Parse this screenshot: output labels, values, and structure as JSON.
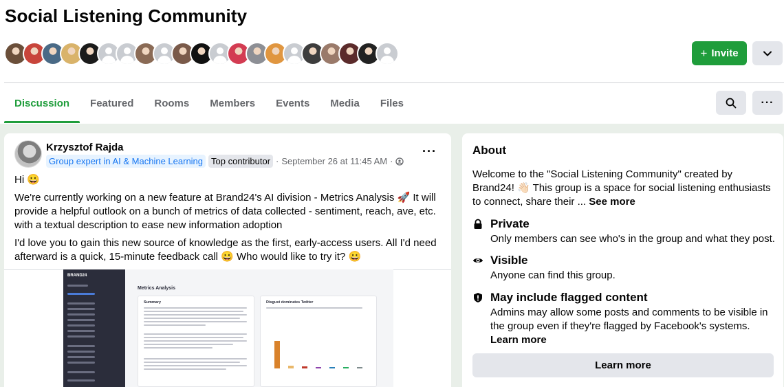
{
  "group": {
    "title": "Social Listening Community",
    "invite_label": "Invite",
    "members_avatars": [
      {
        "color": "#6b4f3a"
      },
      {
        "color": "#c8453b"
      },
      {
        "color": "#4a6a86"
      },
      {
        "color": "#d9b36a"
      },
      {
        "color": "#1b1b1b"
      },
      {
        "color": "blank"
      },
      {
        "color": "blank"
      },
      {
        "color": "#8a6a55"
      },
      {
        "color": "blank"
      },
      {
        "color": "#7a5a4a"
      },
      {
        "color": "#111111"
      },
      {
        "color": "blank"
      },
      {
        "color": "#d33c52"
      },
      {
        "color": "#8d8f95"
      },
      {
        "color": "#e09640"
      },
      {
        "color": "blank"
      },
      {
        "color": "#3d3d3d"
      },
      {
        "color": "#9a7a6a"
      },
      {
        "color": "#5b2b2b"
      },
      {
        "color": "#222222"
      },
      {
        "color": "blank"
      }
    ]
  },
  "tabs": [
    {
      "label": "Discussion"
    },
    {
      "label": "Featured"
    },
    {
      "label": "Rooms"
    },
    {
      "label": "Members"
    },
    {
      "label": "Events"
    },
    {
      "label": "Media"
    },
    {
      "label": "Files"
    }
  ],
  "post": {
    "author": "Krzysztof Rajda",
    "badge_expert": "Group expert in AI & Machine Learning",
    "badge_contributor": "Top contributor",
    "timestamp": "September 26 at 11:45 AM",
    "line1": "Hi 😀",
    "line2": "We're currently working on a new feature at Brand24's AI division - Metrics Analysis 🚀 It will provide a helpful outlook on a bunch of metrics of data collected - sentiment, reach, ave, etc. with a textual description to ease new information adoption",
    "line3": "I'd love you to gain this new source of knowledge as the first, early-access users. All I'd need afterward is a quick, 15-minute feedback call 😀 Who would like to try it? 😀",
    "screenshot": {
      "app_logo": "BRAND24",
      "page_title": "Metrics Analysis",
      "card1_title": "Summary",
      "card2_title": "Disgust dominates Twitter"
    }
  },
  "about": {
    "title": "About",
    "description": "Welcome to the \"Social Listening Community\" created by Brand24! 👋🏻 This group is a space for social listening enthusiasts to connect, share their ...",
    "see_more": "See more",
    "private_title": "Private",
    "private_desc": "Only members can see who's in the group and what they post.",
    "visible_title": "Visible",
    "visible_desc": "Anyone can find this group.",
    "flagged_title": "May include flagged content",
    "flagged_desc": "Admins may allow some posts and comments to be visible in the group even if they're flagged by Facebook's systems.",
    "flagged_learn_more": "Learn more",
    "learn_more_button": "Learn more"
  }
}
